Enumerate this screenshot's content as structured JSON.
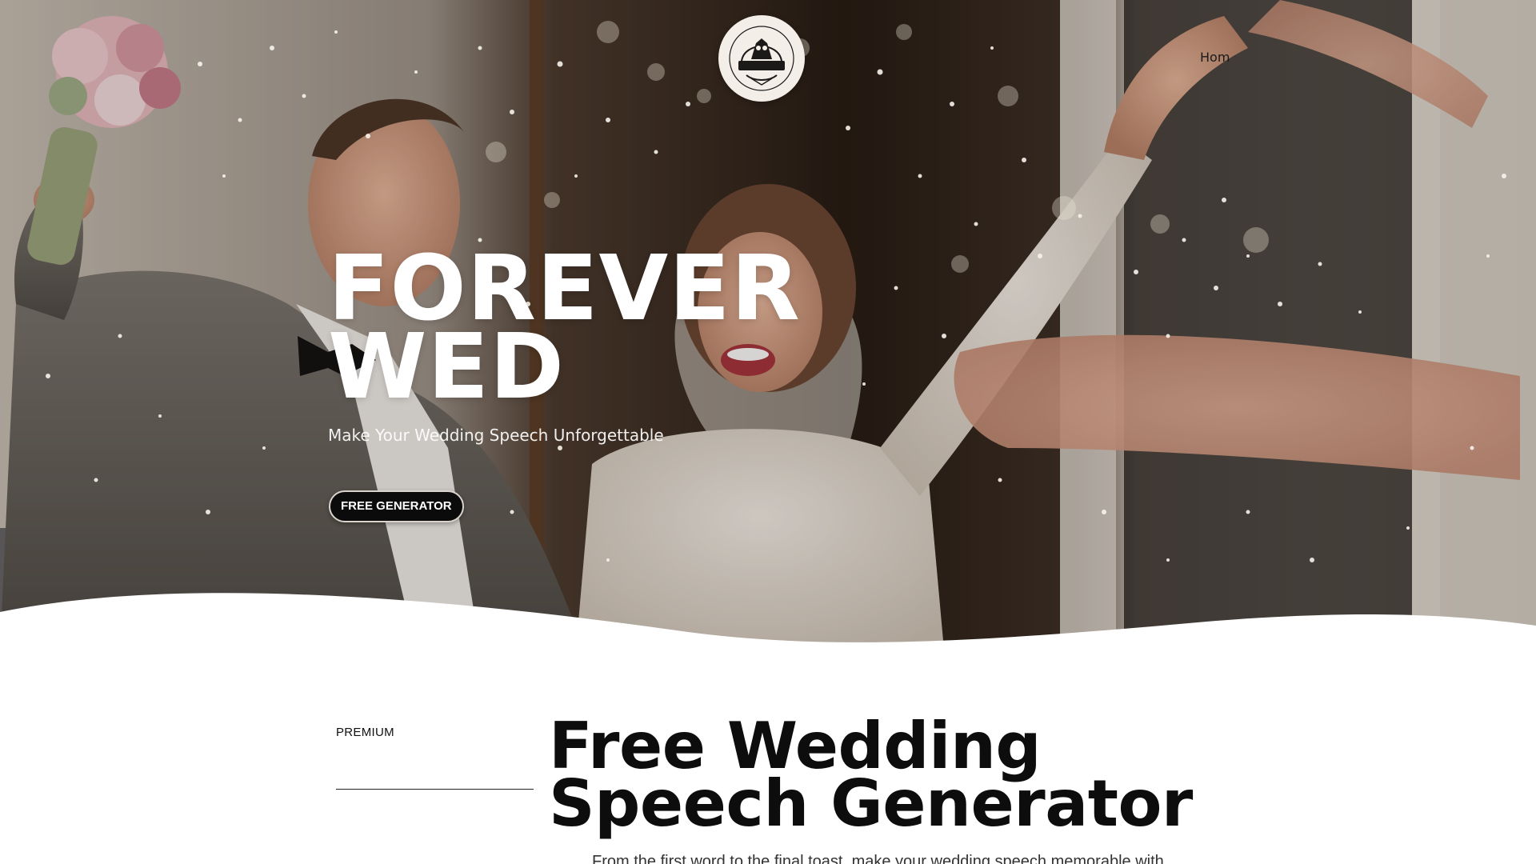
{
  "brand": {
    "logo_text": "FOREVER WED",
    "hero_title_line1": "FOREVER",
    "hero_title_line2": "WED",
    "tagline": "Make Your Wedding Speech Unforgettable"
  },
  "nav": {
    "home_label": "Hom"
  },
  "hero": {
    "cta_label": "FREE GENERATOR"
  },
  "section": {
    "eyebrow": "PREMIUM",
    "title_line1": "Free Wedding",
    "title_line2": "Speech Generator",
    "body": "From the first word to the final toast, make your wedding speech memorable with"
  },
  "colors": {
    "cta_background": "#0b0b0b",
    "text_dark": "#0d0d0d",
    "hero_text": "#ffffff"
  }
}
